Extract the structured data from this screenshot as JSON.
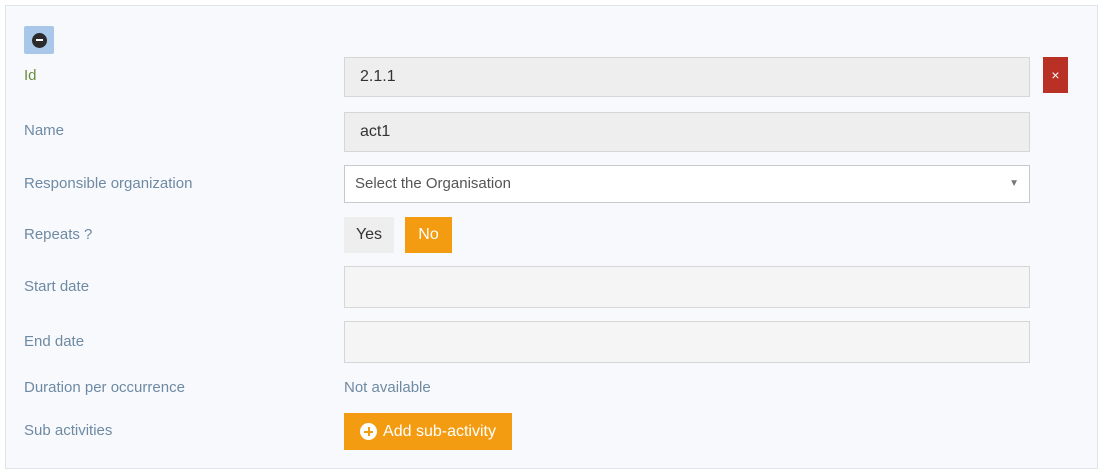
{
  "form": {
    "id_label": "Id",
    "id_value": "2.1.1",
    "name_label": "Name",
    "name_value": "act1",
    "org_label": "Responsible organization",
    "org_placeholder": "Select the Organisation",
    "repeats_label": "Repeats ?",
    "repeats_yes": "Yes",
    "repeats_no": "No",
    "repeats_selected": "No",
    "start_label": "Start date",
    "start_value": "",
    "end_label": "End date",
    "end_value": "",
    "duration_label": "Duration per occurrence",
    "duration_value": "Not available",
    "sub_label": "Sub activities",
    "add_sub_label": "Add sub-activity",
    "remove_symbol": "×"
  },
  "icons": {
    "collapse": "minus-circle-icon",
    "remove": "close-icon",
    "add": "plus-circle-icon",
    "caret": "chevron-down-icon"
  },
  "colors": {
    "accent_orange": "#f39c12",
    "danger_red": "#b93125",
    "label_blue": "#6e8aa3",
    "id_label_green": "#6b8e3d",
    "collapse_blue": "#a9c7e8"
  }
}
